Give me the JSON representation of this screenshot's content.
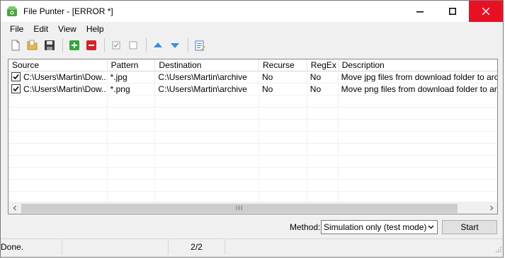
{
  "window": {
    "title": "File Punter - [ERROR *]",
    "icon": "app-icon",
    "controls": [
      "minimize-icon",
      "maximize-icon",
      "close-icon"
    ],
    "close_color": "#e81123"
  },
  "menu": [
    "File",
    "Edit",
    "View",
    "Help"
  ],
  "toolbar": {
    "icons": [
      "new-file-icon",
      "open-folder-icon",
      "save-icon",
      "add-icon",
      "remove-icon",
      "check-all-icon",
      "uncheck-all-icon",
      "move-up-icon",
      "move-down-icon",
      "edit-icon"
    ]
  },
  "grid": {
    "columns": [
      "Source",
      "Pattern",
      "Destination",
      "Recurse",
      "RegEx",
      "Description"
    ],
    "rows": [
      {
        "checked": true,
        "source": "C:\\Users\\Martin\\Dow...",
        "pattern": "*.jpg",
        "destination": "C:\\Users\\Martin\\archive",
        "recurse": "No",
        "regex": "No",
        "description": "Move jpg files from download folder to archive"
      },
      {
        "checked": true,
        "source": "C:\\Users\\Martin\\Dow...",
        "pattern": "*.png",
        "destination": "C:\\Users\\Martin\\archive",
        "recurse": "No",
        "regex": "No",
        "description": "Move png files from download folder to archive"
      }
    ],
    "scroll_thumb_glyph": "III"
  },
  "method": {
    "label": "Method:",
    "selected": "Simulation only (test mode)",
    "start_label": "Start"
  },
  "status": {
    "message": "Done.",
    "count": "2/2"
  }
}
